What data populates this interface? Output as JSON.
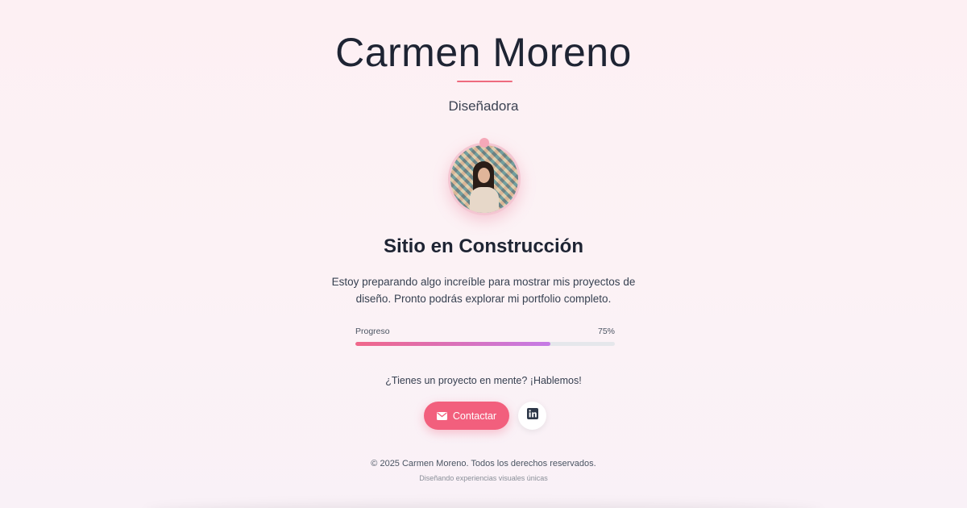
{
  "header": {
    "name": "Carmen Moreno",
    "role": "Diseñadora"
  },
  "main": {
    "heading": "Sitio en Construcción",
    "description": "Estoy preparando algo increíble para mostrar mis proyectos de diseño. Pronto podrás explorar mi portfolio completo."
  },
  "progress": {
    "label": "Progreso",
    "value_text": "75%",
    "fraction": 0.75
  },
  "cta": {
    "text": "¿Tienes un proyecto en mente? ¡Hablemos!",
    "contact_label": "Contactar",
    "contact_icon": "mail-icon",
    "linkedin_icon": "linkedin-icon"
  },
  "footer": {
    "copyright": "© 2025 Carmen Moreno. Todos los derechos reservados.",
    "tagline": "Diseñando experiencias visuales únicas"
  },
  "colors": {
    "accent": "#f25f7d",
    "progress_start": "#f0678a",
    "progress_end": "#c57be6",
    "text_dark": "#1e2433"
  }
}
